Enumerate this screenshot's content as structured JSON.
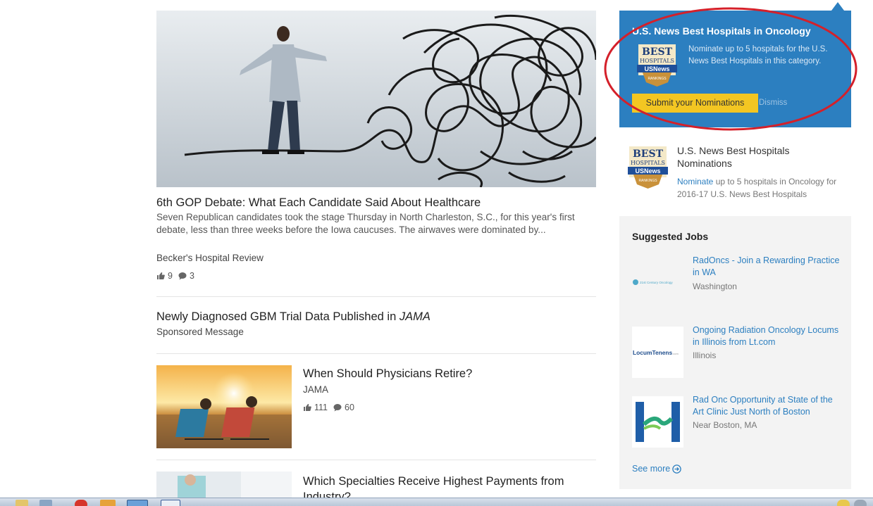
{
  "feed": {
    "articles": [
      {
        "title": "6th GOP Debate: What Each Candidate Said About Healthcare",
        "snippet": "Seven Republican candidates took the stage Thursday in North Charleston, S.C., for this year's first debate, less than three weeks before the Iowa caucuses. The airwaves were dominated by...",
        "source": "Becker's Hospital Review",
        "likes": "9",
        "comments": "3"
      },
      {
        "title_prefix": "Newly Diagnosed GBM Trial Data Published in ",
        "title_em": "JAMA",
        "source": "Sponsored Message"
      },
      {
        "title": "When Should Physicians Retire?",
        "source": "JAMA",
        "likes": "111",
        "comments": "60"
      },
      {
        "title": "Which Specialties Receive Highest Payments from Industry?"
      }
    ]
  },
  "promo": {
    "title": "U.S. News Best Hospitals in Oncology",
    "text": "Nominate up to 5 hospitals for the U.S. News Best Hospitals in this category.",
    "submit_label": "Submit your Nominations",
    "dismiss_label": "Dismiss"
  },
  "badge": {
    "line1": "BEST",
    "line2": "HOSPITALS",
    "line3": "USNews",
    "line4": "RANKINGS"
  },
  "nominations": {
    "title": "U.S. News Best Hospitals Nominations",
    "link_text": "Nominate",
    "text_rest": " up to 5 hospitals in Oncology for 2016-17 U.S. News Best Hospitals"
  },
  "jobs": {
    "heading": "Suggested Jobs",
    "items": [
      {
        "title": "RadOncs - Join a Rewarding Practice in WA",
        "location": "Washington",
        "logo_text": "21st Century Oncology"
      },
      {
        "title": "Ongoing Radiation Oncology Locums in Illinois from Lt.com",
        "location": "Illinois",
        "logo_text": "LocumTenens",
        "logo_suffix": ".com"
      },
      {
        "title": "Rad Onc Opportunity at State of the Art Clinic Just North of Boston",
        "location": "Near Boston, MA"
      }
    ],
    "see_more": "See more"
  },
  "colors": {
    "accent": "#2c7fc0",
    "button": "#f3c622",
    "annotation": "#d4202a"
  },
  "icons": [
    "like-icon",
    "comment-icon",
    "arrow-circle-right-icon"
  ]
}
